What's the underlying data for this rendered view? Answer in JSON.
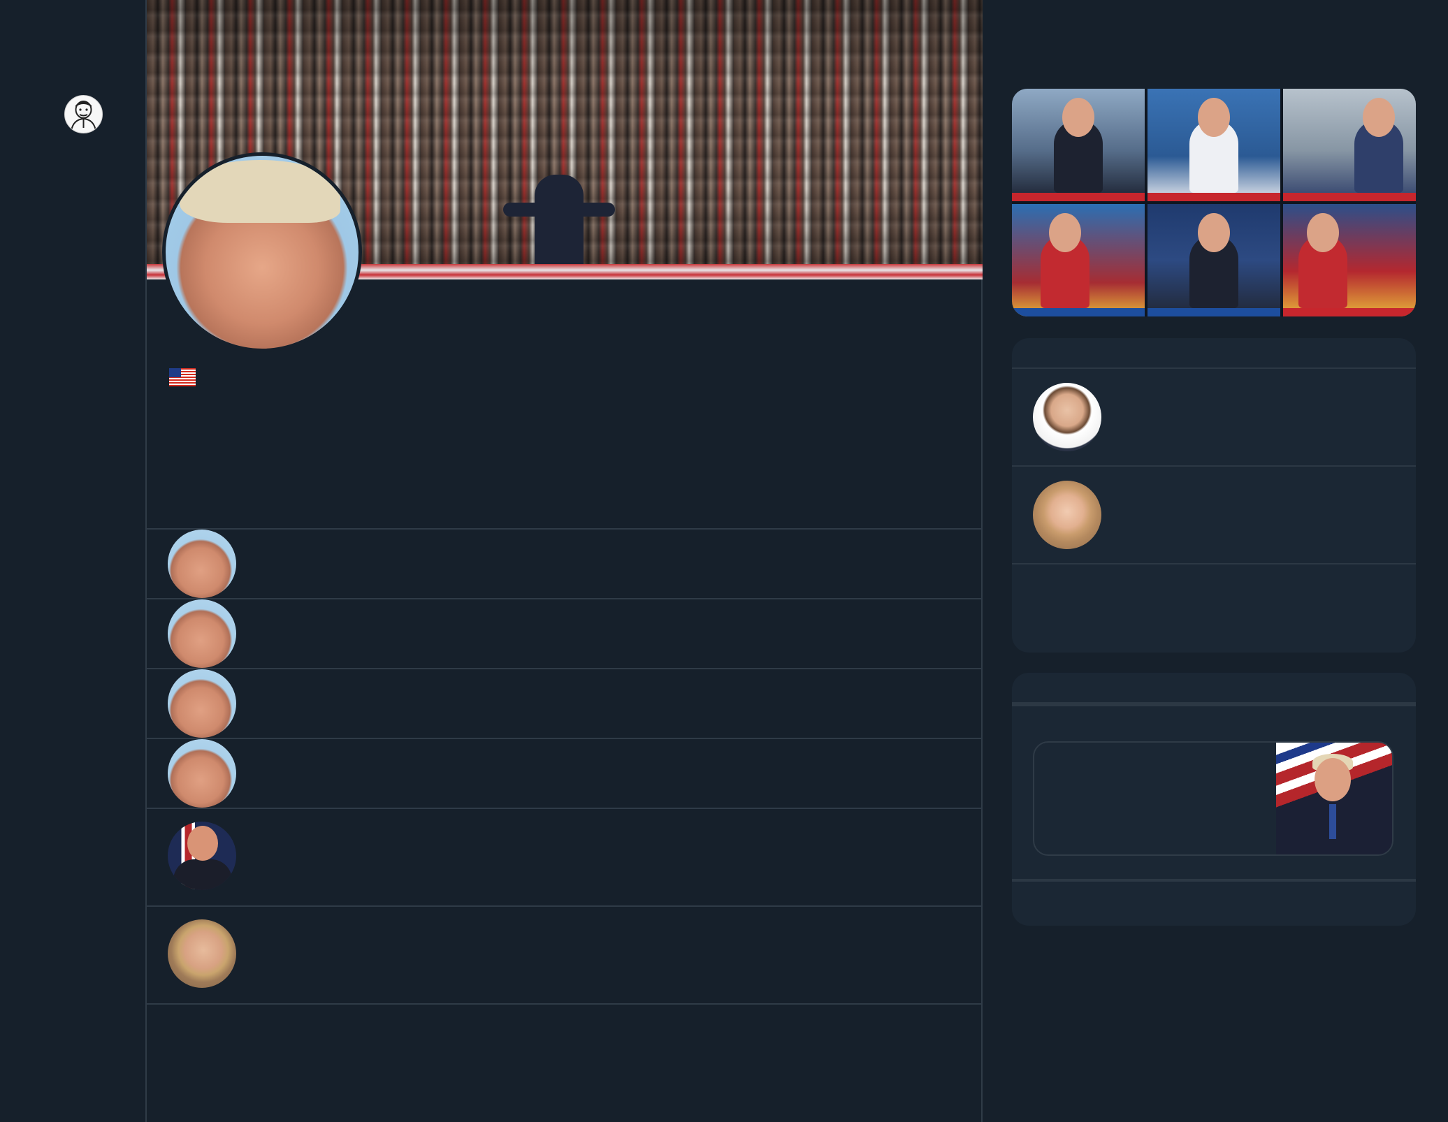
{
  "colors": {
    "background": "#16202b",
    "divider": "#2f3b47",
    "card": "#1b2734"
  },
  "sidebar": {
    "logo_icon": "cartoon-portrait-logo"
  },
  "profile": {
    "banner_image": "rally-crowd-banner",
    "avatar_image": "profile-portrait",
    "location_icon": "us-flag-icon"
  },
  "feed": {
    "rows": [
      {
        "avatar": "portrait-avatar"
      },
      {
        "avatar": "portrait-avatar"
      },
      {
        "avatar": "portrait-avatar"
      },
      {
        "avatar": "portrait-avatar"
      },
      {
        "avatar": "flag-backdrop-avatar"
      },
      {
        "avatar": "portrait-avatar"
      }
    ]
  },
  "right_column": {
    "media_grid": [
      "news-clip",
      "news-clip",
      "news-clip",
      "news-clip",
      "news-clip",
      "news-clip"
    ],
    "follow_suggestions": [
      {
        "avatar": "portrait-avatar"
      },
      {
        "avatar": "portrait-avatar"
      }
    ],
    "news_card": {
      "thumbnail": "news-thumbnail"
    }
  }
}
